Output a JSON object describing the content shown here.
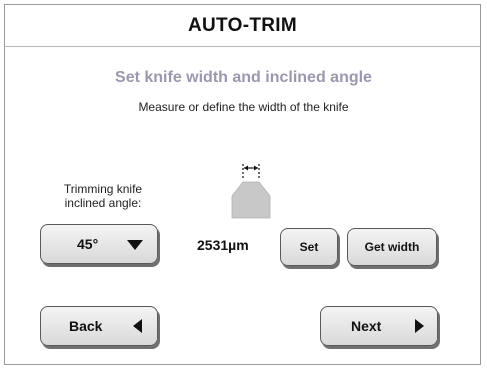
{
  "header": {
    "title": "AUTO-TRIM"
  },
  "main": {
    "subtitle": "Set knife width and inclined angle",
    "instruction": "Measure or define the width of the knife",
    "angle": {
      "label_line1": "Trimming knife",
      "label_line2": "inclined angle:",
      "selected": "45°"
    },
    "knife_width": "2531µm",
    "set_label": "Set",
    "get_width_label": "Get width"
  },
  "footer": {
    "back_label": "Back",
    "next_label": "Next"
  },
  "colors": {
    "subtitle": "#9a98ad",
    "knife_fill": "#c8c8c8",
    "button_bg": "#e6e6e6"
  },
  "icons": {
    "angle_dropdown": "triangle-down-icon",
    "back": "triangle-left-icon",
    "next": "triangle-right-icon",
    "knife": "knife-width-diagram-icon"
  }
}
